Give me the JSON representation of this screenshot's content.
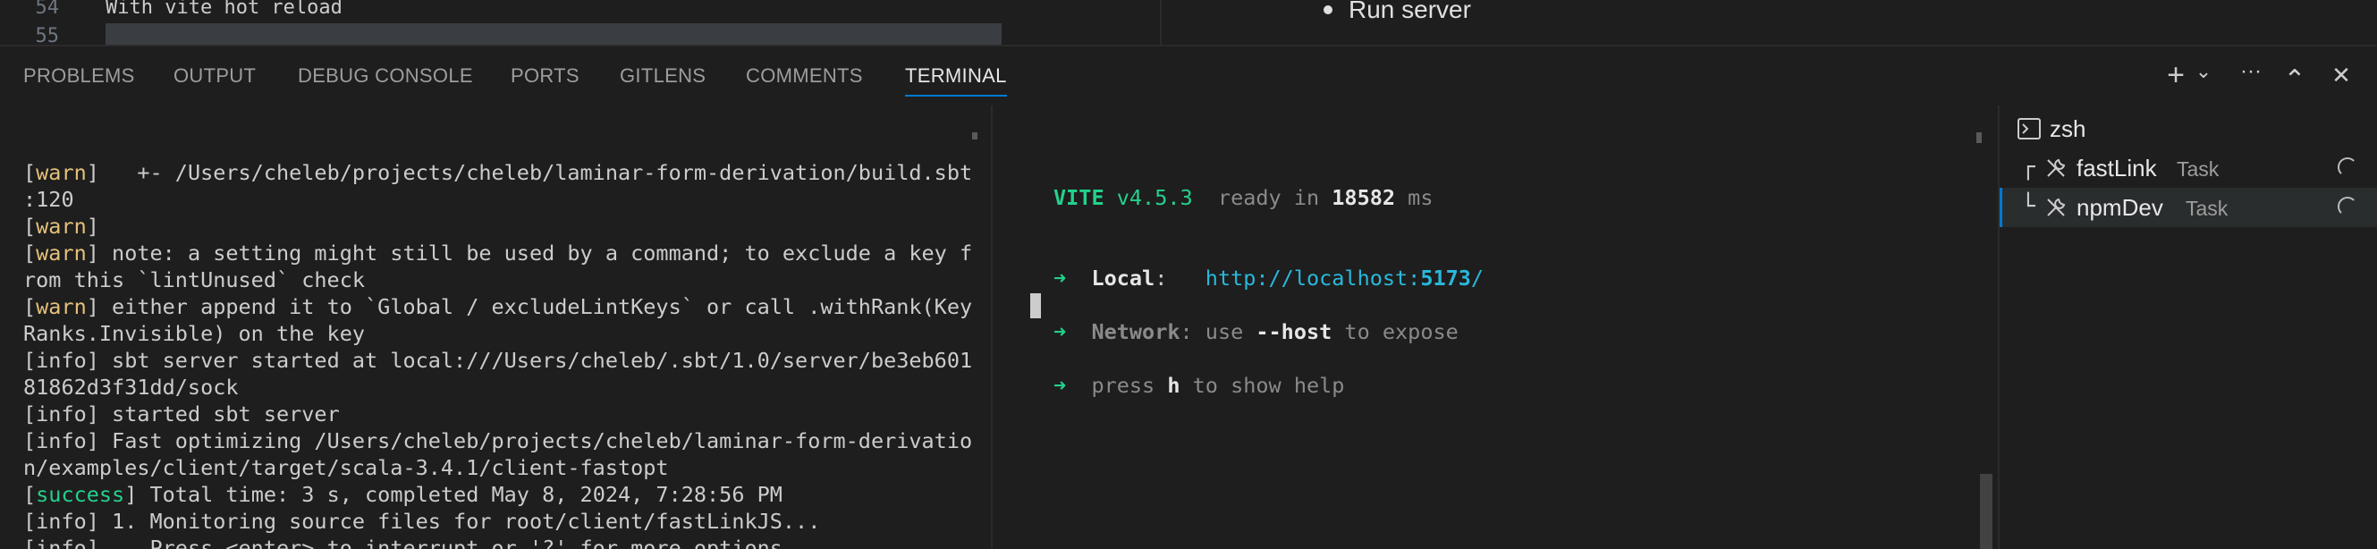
{
  "editor": {
    "line_numbers": [
      "54",
      "55"
    ],
    "code_line": "With vite hot reload",
    "preview_item": "Run server"
  },
  "panel": {
    "tabs": [
      {
        "label": "PROBLEMS"
      },
      {
        "label": "OUTPUT"
      },
      {
        "label": "DEBUG CONSOLE"
      },
      {
        "label": "PORTS"
      },
      {
        "label": "GITLENS"
      },
      {
        "label": "COMMENTS"
      },
      {
        "label": "TERMINAL",
        "active": true
      }
    ],
    "actions": {
      "add": "+",
      "add_dropdown": "⌄",
      "more": "···",
      "maximize": "⌃",
      "close": "✕"
    }
  },
  "terminal_left": {
    "lines": [
      {
        "tag": "warn",
        "text": "   +- /Users/cheleb/projects/cheleb/laminar-form-derivation/build.sbt"
      },
      {
        "tag": null,
        "text": ":120"
      },
      {
        "tag": "warn",
        "text": ""
      },
      {
        "tag": "warn",
        "text": " note: a setting might still be used by a command; to exclude a key f"
      },
      {
        "tag": null,
        "text": "rom this `lintUnused` check"
      },
      {
        "tag": "warn",
        "text": " either append it to `Global / excludeLintKeys` or call .withRank(Key"
      },
      {
        "tag": null,
        "text": "Ranks.Invisible) on the key"
      },
      {
        "tag": "info",
        "text": " sbt server started at local:///Users/cheleb/.sbt/1.0/server/be3eb601"
      },
      {
        "tag": null,
        "text": "81862d3f31dd/sock"
      },
      {
        "tag": "info",
        "text": " started sbt server"
      },
      {
        "tag": "info",
        "text": " Fast optimizing /Users/cheleb/projects/cheleb/laminar-form-derivatio"
      },
      {
        "tag": null,
        "text": "n/examples/client/target/scala-3.4.1/client-fastopt"
      },
      {
        "tag": "success",
        "text": " Total time: 3 s, completed May 8, 2024, 7:28:56 PM"
      },
      {
        "tag": "info",
        "text": " 1. Monitoring source files for root/client/fastLinkJS..."
      },
      {
        "tag": "info",
        "text": "    Press <enter> to interrupt or '?' for more options."
      }
    ]
  },
  "terminal_right": {
    "vite_name": "VITE",
    "vite_version": "v4.5.3",
    "ready_text": "  ready in ",
    "ready_ms": "18582",
    "ms": " ms",
    "arrow": "➜",
    "local_label": "Local",
    "local_colon": ":   ",
    "local_url_prefix": "http://localhost:",
    "local_port": "5173",
    "local_url_suffix": "/",
    "network_label": "Network",
    "network_text_a": ": use ",
    "network_flag": "--host",
    "network_text_b": " to expose",
    "help_a": "press ",
    "help_key": "h",
    "help_b": " to show help"
  },
  "terminal_list": {
    "items": [
      {
        "name": "zsh",
        "task": ""
      },
      {
        "name": "fastLink",
        "task": "Task"
      },
      {
        "name": "npmDev",
        "task": "Task",
        "selected": true
      }
    ]
  }
}
